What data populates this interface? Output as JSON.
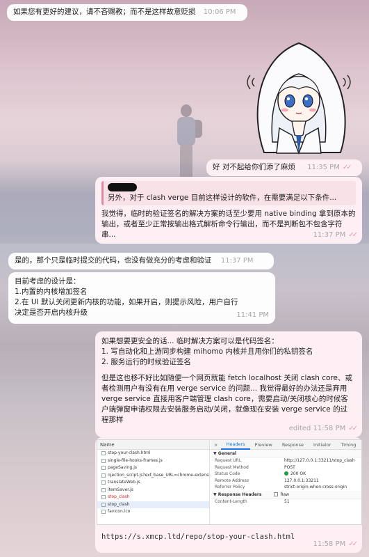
{
  "messages": {
    "m1": {
      "text": "如果您有更好的建议，请不吝赐教；而不是这样故意贬损",
      "time": "10:06 PM"
    },
    "m2": {
      "text": "好 对不起给你们添了麻烦",
      "time": "11:35 PM"
    },
    "m3": {
      "quote": "另外，对于 clash verge 目前这样设计的软件，在需要满足以下条件...",
      "text": "我觉得，临时的验证签名的解决方案的话至少要用 native binding 拿到原本的输出，或者至少正常按输出格式解析命令行输出，而不是判断包不包含字符串...",
      "time": "11:37 PM"
    },
    "m4": {
      "text": "是的，那个只是临时提交的代码，也没有做充分的考虑和验证",
      "time": "11:37 PM"
    },
    "m5": {
      "lines": [
        "目前考虑的设计是：",
        "1.内置的内核增加签名",
        "2.在 UI 默认关闭更新内核的功能，如果开启，则提示风险，用户自行决定是否开启内核升级"
      ],
      "time": "11:41 PM"
    },
    "m6": {
      "para1": [
        "如果想要更安全的话... 临时解决方案可以是代码签名：",
        "1. 写自动化和上游同步构建 mihomo 内核并且用你们的私钥签名",
        "2. 服务运行的时候验证签名"
      ],
      "para2": "但是这也移不好比如随便一个网页就能 fetch localhost 关闭 clash core、或者检测用户有没有在用 verge service 的问题... 我觉得最好的办法还是弃用 verge service 直接用客户端管理 clash core，需要启动/关闭核心的时候客户端弹窗申请权限去安装服务启动/关闭，就像现在安装 verge service 的过程那样",
      "status": "edited 11:58 PM"
    },
    "m7": {
      "link": "https://s.xmcp.ltd/repo/stop-your-clash.html",
      "time": "11:58 PM"
    }
  },
  "ticks": "✓✓",
  "devtools": {
    "name_header": "Name",
    "files": [
      {
        "name": "stop-your-clash.html",
        "state": "normal"
      },
      {
        "name": "single-file-hooks-frames.js",
        "state": "normal"
      },
      {
        "name": "pageSaving.js",
        "state": "normal"
      },
      {
        "name": "njection_script.js?ext_base_URL=chrome-extensi...",
        "state": "normal"
      },
      {
        "name": "translateWeb.js",
        "state": "normal"
      },
      {
        "name": "itemSaver.js",
        "state": "normal"
      },
      {
        "name": "stop_clash",
        "state": "red"
      },
      {
        "name": "stop_clash",
        "state": "selected"
      },
      {
        "name": "favicon.ico",
        "state": "normal"
      }
    ],
    "tabs": [
      "×",
      "Headers",
      "Preview",
      "Response",
      "Initiator",
      "Timing"
    ],
    "general_title": "▼ General",
    "general": [
      {
        "k": "Request URL",
        "v": "http://127.0.0.1:33211/stop_clash"
      },
      {
        "k": "Request Method",
        "v": "POST"
      },
      {
        "k": "Status Code",
        "v": "200 OK"
      },
      {
        "k": "Remote Address",
        "v": "127.0.0.1:33211"
      },
      {
        "k": "Referrer Policy",
        "v": "strict-origin-when-cross-origin"
      }
    ],
    "response_title": "▼ Response Headers",
    "raw_label": "Raw",
    "response": [
      {
        "k": "Content-Length",
        "v": "51"
      }
    ]
  },
  "colors": {
    "accent": "#e39bb0",
    "status_ok": "#1e9e3f",
    "tab_active": "#1a73e8"
  }
}
